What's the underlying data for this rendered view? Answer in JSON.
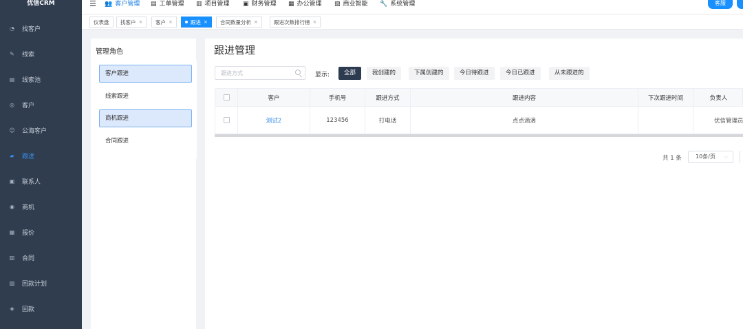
{
  "app": {
    "logo": "优信CRM"
  },
  "sidebar": {
    "items": [
      {
        "label": "找客户",
        "icon": "find-customer-icon",
        "glyph": "◔"
      },
      {
        "label": "线索",
        "icon": "edit-icon",
        "glyph": "✎"
      },
      {
        "label": "线索池",
        "icon": "pool-icon",
        "glyph": "▤"
      },
      {
        "label": "客户",
        "icon": "customer-icon",
        "glyph": "◎"
      },
      {
        "label": "公海客户",
        "icon": "user-icon",
        "glyph": "☺"
      },
      {
        "label": "跟进",
        "icon": "followup-icon",
        "glyph": "▰",
        "active": true
      },
      {
        "label": "联系人",
        "icon": "contact-icon",
        "glyph": "▣"
      },
      {
        "label": "商机",
        "icon": "opportunity-icon",
        "glyph": "◉"
      },
      {
        "label": "报价",
        "icon": "quote-icon",
        "glyph": "▦"
      },
      {
        "label": "合同",
        "icon": "contract-icon",
        "glyph": "▥"
      },
      {
        "label": "回款计划",
        "icon": "payment-plan-icon",
        "glyph": "▧"
      },
      {
        "label": "回款",
        "icon": "payment-icon",
        "glyph": "◈"
      }
    ]
  },
  "topnav": {
    "items": [
      {
        "label": "客户管理",
        "icon": "users-icon",
        "glyph": "👥",
        "active": true
      },
      {
        "label": "工单管理",
        "icon": "ticket-icon",
        "glyph": "▤"
      },
      {
        "label": "项目管理",
        "icon": "project-icon",
        "glyph": "▥"
      },
      {
        "label": "财务管理",
        "icon": "finance-icon",
        "glyph": "▣"
      },
      {
        "label": "办公管理",
        "icon": "office-icon",
        "glyph": "▦"
      },
      {
        "label": "商业智能",
        "icon": "bi-icon",
        "glyph": "▧"
      },
      {
        "label": "系统管理",
        "icon": "wrench-icon",
        "glyph": "🔧"
      }
    ],
    "kefu_label": "客服"
  },
  "tabs": [
    {
      "label": "仪表盘",
      "closable": false
    },
    {
      "label": "找客户",
      "closable": true
    },
    {
      "label": "客户",
      "closable": true
    },
    {
      "label": "跟进",
      "closable": true,
      "active": true
    },
    {
      "label": "合同数量分析",
      "closable": true
    },
    {
      "label": "跟进次数排行榜",
      "closable": true
    }
  ],
  "roles": {
    "title": "管理角色",
    "items": [
      {
        "label": "客户跟进",
        "selected": true
      },
      {
        "label": "线索跟进",
        "selected": false
      },
      {
        "label": "商机跟进",
        "selected": true
      },
      {
        "label": "合同跟进",
        "selected": false
      }
    ]
  },
  "main": {
    "title": "跟进管理",
    "search_placeholder": "跟进方式",
    "filter_label": "显示:",
    "filters": [
      {
        "label": "全部",
        "active": true
      },
      {
        "label": "我创建的",
        "active": false
      },
      {
        "label": "下属创建的",
        "active": false
      },
      {
        "label": "今日待跟进",
        "active": false
      },
      {
        "label": "今日已跟进",
        "active": false
      },
      {
        "label": "从未跟进的",
        "active": false
      }
    ],
    "columns": [
      "客户",
      "手机号",
      "跟进方式",
      "跟进内容",
      "下次跟进时间",
      "负责人"
    ],
    "rows": [
      {
        "customer": "测试2",
        "phone": "123456",
        "method": "打电话",
        "content": "点点滴滴",
        "next_time": "",
        "owner": "优信管理员"
      }
    ],
    "pagination": {
      "total_text": "共 1 条",
      "page_size": "10条/页"
    }
  }
}
